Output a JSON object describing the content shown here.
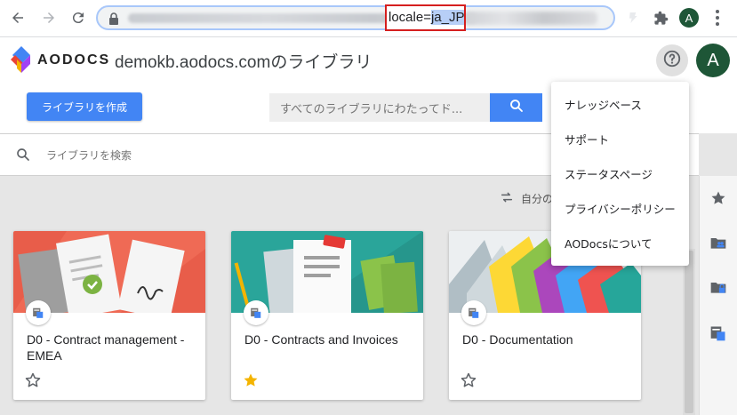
{
  "browser": {
    "url_param": "locale=",
    "url_param_value": "ja_JP",
    "profile_initial": "A"
  },
  "header": {
    "brand": "AODOCS",
    "title": "demokb.aodocs.comのライブラリ",
    "avatar_initial": "A"
  },
  "toolbar": {
    "create_label": "ライブラリを作成",
    "search_placeholder": "すべてのライブラリにわたってド..."
  },
  "library_search": {
    "placeholder": "ライブラリを検索"
  },
  "main": {
    "sort_label": "自分の"
  },
  "cards": [
    {
      "title": "D0 - Contract management - EMEA",
      "starred": false
    },
    {
      "title": "D0 - Contracts and Invoices",
      "starred": true
    },
    {
      "title": "D0 - Documentation",
      "starred": false
    }
  ],
  "menu": {
    "items": [
      {
        "label": "ナレッジベース"
      },
      {
        "label": "サポート"
      },
      {
        "label": "ステータスページ"
      },
      {
        "label": "プライバシーポリシー"
      },
      {
        "label": "AODocsについて"
      }
    ]
  },
  "colors": {
    "accent": "#4285f4",
    "avatar": "#1e5637",
    "highlight_box": "#d51f1f",
    "star_active": "#f4b400"
  },
  "icons": {
    "back": "arrow-left-icon",
    "forward": "arrow-right-icon",
    "reload": "reload-icon",
    "lock": "lock-icon",
    "extensions": "puzzle-icon",
    "help": "help-circle-icon",
    "search": "search-icon",
    "sort": "sort-swap-icon",
    "star": "star-icon",
    "shared_folder": "shared-folder-icon",
    "locked_folder": "locked-folder-icon",
    "library": "library-icon"
  }
}
